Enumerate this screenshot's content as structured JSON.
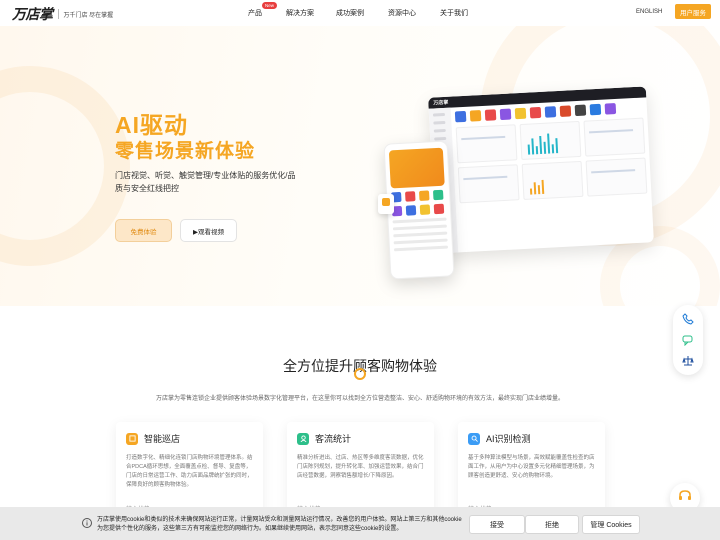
{
  "header": {
    "logo_text": "万店掌",
    "logo_sub": "万千门店 尽在掌握",
    "nav": [
      {
        "label": "产品",
        "badge": "New"
      },
      {
        "label": "解决方案"
      },
      {
        "label": "成功案例"
      },
      {
        "label": "资源中心"
      },
      {
        "label": "关于我们"
      }
    ],
    "lang": "ENGLISH",
    "cta": "用户服务"
  },
  "hero": {
    "title": "AI驱动",
    "subtitle": "零售场景新体验",
    "desc": "门店视觉、听觉、触觉管理/专业体贴的服务优化/品质与安全红线把控",
    "btn_primary": "免费体验",
    "btn_secondary": "▶观看视频"
  },
  "section": {
    "title": "全方位提升顾客购物体验",
    "desc": "万店掌为零售连锁企业提供顾客体验场景数字化管理平台，在这里你可以找到全方位营造整洁、安心、舒适购物环境的有效方法，最终实现门店业绩增量。"
  },
  "cards": [
    {
      "title": "智能巡店",
      "desc": "打造数字化、精细化连锁门店购物环境管理体系。结合PDCA循环思想，全面覆盖点检、督导、复盘等，门店的日常运营工作、助力店面品牌统扩张的同时，保障良好的顾客购物体验。",
      "sub": "核心优势",
      "color": "#f5a623"
    },
    {
      "title": "客流统计",
      "desc": "精准分析进出、过店、热区等多维度客流数据，优化门店陈列规划，提升转化率、加强运营效果，结合门店经营数据，洞察销售额增长/下降原因。",
      "sub": "核心优势",
      "color": "#2dbf8a"
    },
    {
      "title": "AI识别检测",
      "desc": "基于多种算法模型与场景，高效赋能覆盖性检查的店面工作，从用户为中心设置多元化精细管理场景，为顾客创造更舒适、安心的购物环境。",
      "sub": "核心优势",
      "color": "#3b9cf5"
    }
  ],
  "cookie": {
    "text": "万店掌使用cookie和类似的技术来确保网站运行正常，计量网站受众和测量网站运行情况，改善您的用户体验。网站上第三方和其他cookie为您提供个性化的服务，这些第三方有可能监控您的网络行为。如果继续使用网站，表示您同意这些cookie的设置。",
    "accept": "接受",
    "reject": "拒绝",
    "manage": "管理 Cookies"
  },
  "dashboard": {
    "logo": "万店掌"
  }
}
